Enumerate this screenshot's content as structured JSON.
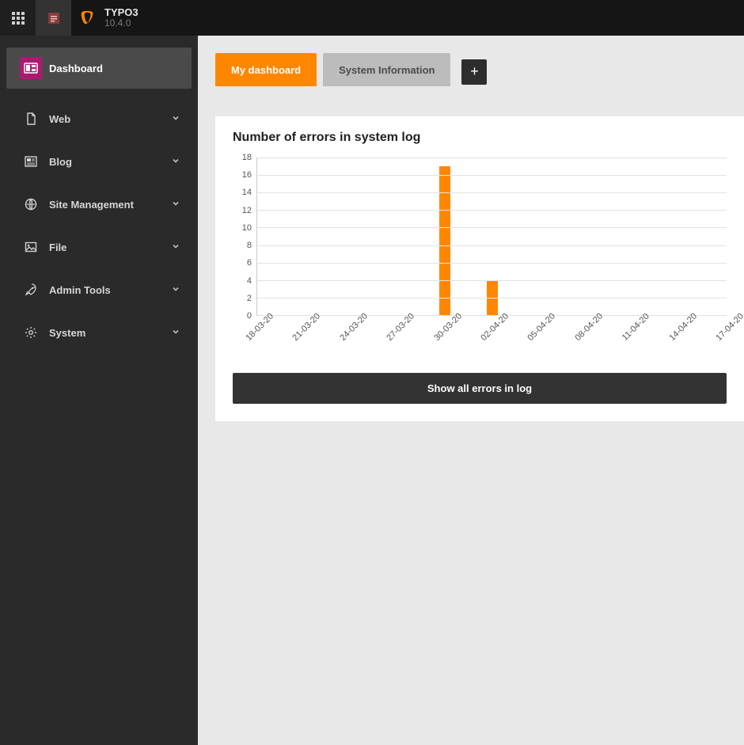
{
  "brand": {
    "name": "TYPO3",
    "version": "10.4.0"
  },
  "sidebar": {
    "items": [
      {
        "label": "Dashboard",
        "active": true,
        "expandable": false,
        "icon": "dashboard-icon"
      },
      {
        "label": "Web",
        "active": false,
        "expandable": true,
        "icon": "file-icon"
      },
      {
        "label": "Blog",
        "active": false,
        "expandable": true,
        "icon": "news-icon"
      },
      {
        "label": "Site Management",
        "active": false,
        "expandable": true,
        "icon": "globe-icon"
      },
      {
        "label": "File",
        "active": false,
        "expandable": true,
        "icon": "image-icon"
      },
      {
        "label": "Admin Tools",
        "active": false,
        "expandable": true,
        "icon": "rocket-icon"
      },
      {
        "label": "System",
        "active": false,
        "expandable": true,
        "icon": "gear-icon"
      }
    ]
  },
  "tabs": {
    "items": [
      {
        "label": "My dashboard",
        "active": true
      },
      {
        "label": "System Information",
        "active": false
      }
    ],
    "add_label": "+"
  },
  "panel": {
    "title": "Number of errors in system log",
    "button_label": "Show all errors in log"
  },
  "colors": {
    "accent": "#ff8700",
    "brand": "#ab1a70"
  },
  "chart_data": {
    "type": "bar",
    "title": "Number of errors in system log",
    "xlabel": "",
    "ylabel": "",
    "ylim": [
      0,
      18
    ],
    "y_ticks": [
      0,
      2,
      4,
      6,
      8,
      10,
      12,
      14,
      16,
      18
    ],
    "categories": [
      "18-03-20",
      "21-03-20",
      "24-03-20",
      "27-03-20",
      "30-03-20",
      "02-04-20",
      "05-04-20",
      "08-04-20",
      "11-04-20",
      "14-04-20",
      "17-04-20"
    ],
    "series": [
      {
        "name": "errors",
        "color": "#ff8700",
        "values": [
          0,
          0,
          0,
          0,
          0,
          0,
          0,
          0,
          0,
          0,
          0,
          0,
          17,
          0,
          0,
          4,
          0,
          0,
          0,
          0,
          0,
          0,
          0,
          0,
          0,
          0,
          0,
          0,
          0,
          0,
          0
        ]
      }
    ]
  }
}
